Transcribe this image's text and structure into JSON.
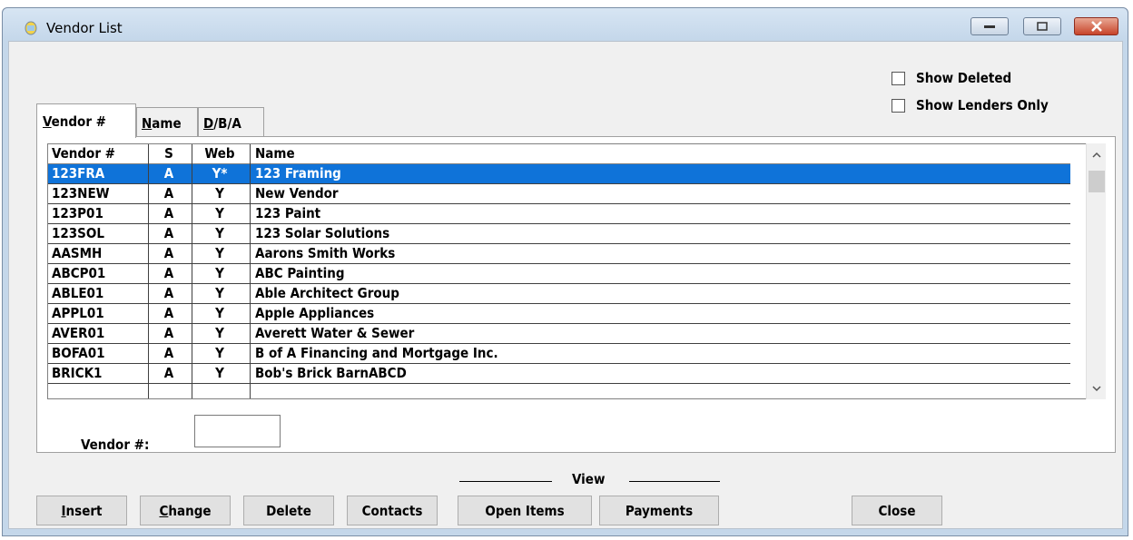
{
  "window": {
    "title": "Vendor List"
  },
  "options": {
    "show_deleted": "Show Deleted",
    "show_lenders_only": "Show Lenders Only"
  },
  "tabs": {
    "vendor": {
      "ul": "V",
      "rest": "endor #"
    },
    "name": {
      "ul": "N",
      "rest": "ame"
    },
    "dba": {
      "ul": "D",
      "rest": "/B/A"
    }
  },
  "grid": {
    "columns": [
      "Vendor #",
      "S",
      "Web",
      "Name"
    ],
    "rows": [
      {
        "vendor": "123FRA",
        "s": "A",
        "web": "Y*",
        "name": "123 Framing"
      },
      {
        "vendor": "123NEW",
        "s": "A",
        "web": "Y",
        "name": "New Vendor"
      },
      {
        "vendor": "123P01",
        "s": "A",
        "web": "Y",
        "name": "123 Paint"
      },
      {
        "vendor": "123SOL",
        "s": "A",
        "web": "Y",
        "name": "123 Solar Solutions"
      },
      {
        "vendor": "AASMH",
        "s": "A",
        "web": "Y",
        "name": "Aarons Smith Works"
      },
      {
        "vendor": "ABCP01",
        "s": "A",
        "web": "Y",
        "name": "ABC Painting"
      },
      {
        "vendor": "ABLE01",
        "s": "A",
        "web": "Y",
        "name": "Able Architect Group"
      },
      {
        "vendor": "APPL01",
        "s": "A",
        "web": "Y",
        "name": "Apple Appliances"
      },
      {
        "vendor": "AVER01",
        "s": "A",
        "web": "Y",
        "name": "Averett Water & Sewer"
      },
      {
        "vendor": "BOFA01",
        "s": "A",
        "web": "Y",
        "name": "B of A Financing and Mortgage Inc."
      },
      {
        "vendor": "BRICK1",
        "s": "A",
        "web": "Y",
        "name": "Bob's Brick BarnABCD"
      },
      {
        "vendor": "",
        "s": "",
        "web": "",
        "name": ""
      }
    ]
  },
  "vendor_field": {
    "label": "Vendor #:",
    "value": ""
  },
  "view_group": "View",
  "buttons": {
    "insert": {
      "ul": "I",
      "rest": "nsert"
    },
    "change": {
      "ul": "C",
      "rest": "hange"
    },
    "delete": "Delete",
    "contacts": "Contacts",
    "open_items": "Open Items",
    "payments": "Payments",
    "close": "Close"
  },
  "colors": {
    "selection": "#0f73d9",
    "frame": "#c4d7ea"
  }
}
